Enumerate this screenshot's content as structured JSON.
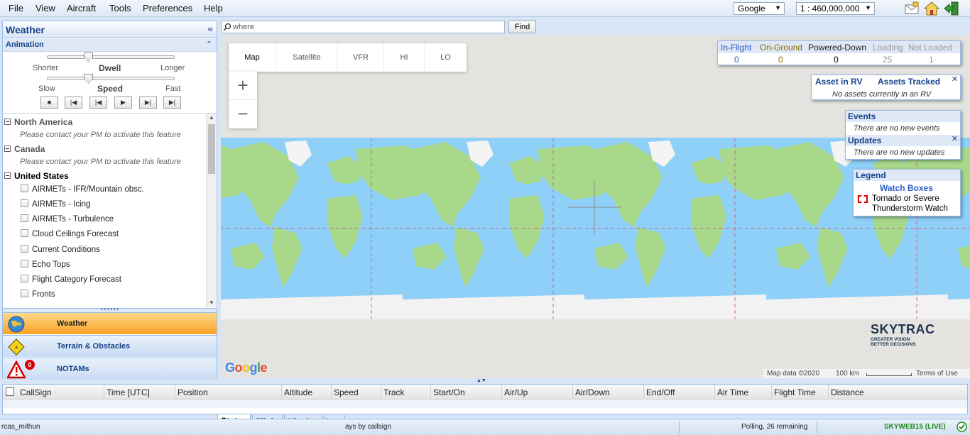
{
  "menu": [
    "File",
    "View",
    "Aircraft",
    "Tools",
    "Preferences",
    "Help"
  ],
  "map_provider": "Google",
  "scale": "1 : 460,000,000",
  "icons": [
    "mail-icon",
    "home-icon",
    "logout-icon"
  ],
  "left": {
    "panel_title": "Weather",
    "animation_title": "Animation",
    "dwell": {
      "min": "Shorter",
      "label": "Dwell",
      "max": "Longer"
    },
    "speed": {
      "min": "Slow",
      "label": "Speed",
      "max": "Fast"
    },
    "regions": [
      {
        "name": "North America",
        "notice": "Please contact your PM to activate this feature"
      },
      {
        "name": "Canada",
        "notice": "Please contact your PM to activate this feature"
      },
      {
        "name": "United States"
      }
    ],
    "layers": [
      "AIRMETs - IFR/Mountain obsc.",
      "AIRMETs - Icing",
      "AIRMETs - Turbulence",
      "Cloud Ceilings Forecast",
      "Current Conditions",
      "Echo Tops",
      "Flight Category Forecast",
      "Fronts"
    ],
    "nav": [
      {
        "label": "Weather"
      },
      {
        "label": "Terrain & Obstacles"
      },
      {
        "label": "NOTAMs",
        "badge": "0"
      }
    ]
  },
  "search": {
    "placeholder": "where",
    "button": "Find"
  },
  "map_types": [
    "Map",
    "Satellite",
    "VFR",
    "HI",
    "LO"
  ],
  "zoom": {
    "in": "+",
    "out": "−"
  },
  "status_box": {
    "headers": [
      "In-Flight",
      "On-Ground",
      "Powered-Down",
      "Loading",
      "Not Loaded"
    ],
    "values": [
      "0",
      "0",
      "0",
      "25",
      "1"
    ]
  },
  "assets_box": {
    "title1": "Asset in RV",
    "title2": "Assets Tracked",
    "message": "No assets currently in an RV"
  },
  "events_box": {
    "title": "Events",
    "message": "There are no new events"
  },
  "updates_box": {
    "title": "Updates",
    "message": "There are no new updates"
  },
  "legend": {
    "title": "Legend",
    "subtitle": "Watch Boxes",
    "line1": "Tornado or Severe",
    "line2": "Thunderstorm Watch"
  },
  "brand": {
    "name": "SKYTRAC",
    "tagline1": "GREATER VISION",
    "tagline2": "BETTER DECISIONS"
  },
  "map_footer": {
    "google": "Google",
    "data": "Map data ©2020",
    "scale": "100 km",
    "terms": "Terms of Use"
  },
  "grid_columns": [
    "CallSign",
    "Time [UTC]",
    "Position",
    "Altitude",
    "Speed",
    "Track",
    "Start/On",
    "Air/Up",
    "Air/Down",
    "End/Off",
    "Air Time",
    "Flight Time",
    "Distance"
  ],
  "tabs": [
    "Status",
    "Flight",
    "Mission",
    "Log"
  ],
  "statusbar": {
    "user": "rcas_mithun",
    "note": "ays by callsign",
    "polling": "Polling, 26 remaining",
    "server": "SKYWEB15 (LIVE)"
  },
  "colors": {
    "accent": "#15428b",
    "ocean": "#8fd0f8",
    "land": "#a8d88a",
    "active_nav": "#f9a326"
  }
}
